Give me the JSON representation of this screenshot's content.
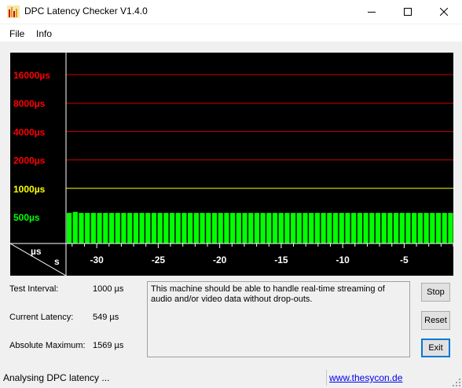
{
  "window": {
    "title": "DPC Latency Checker V1.4.0",
    "icon": "bar-chart-app-icon",
    "controls": [
      "minimize",
      "maximize",
      "close"
    ]
  },
  "menu": {
    "items": [
      "File",
      "Info"
    ]
  },
  "chart_data": {
    "type": "bar",
    "y_scale": "log",
    "y_ticks": [
      {
        "label": "16000µs",
        "value": 16000,
        "color": "#ff0000"
      },
      {
        "label": "8000µs",
        "value": 8000,
        "color": "#ff0000"
      },
      {
        "label": "4000µs",
        "value": 4000,
        "color": "#ff0000"
      },
      {
        "label": "2000µs",
        "value": 2000,
        "color": "#ff0000"
      },
      {
        "label": "1000µs",
        "value": 1000,
        "color": "#ffff00"
      },
      {
        "label": "500µs",
        "value": 500,
        "color": "#00ff00"
      }
    ],
    "x_ticks": [
      "-30",
      "-25",
      "-20",
      "-15",
      "-10",
      "-5"
    ],
    "x_tick_values": [
      -30,
      -25,
      -20,
      -15,
      -10,
      -5
    ],
    "x_range": [
      -32.5,
      -1
    ],
    "y_unit_label": "µs",
    "x_unit_label": "s",
    "bar_color": "#00ff00",
    "background": "#000000",
    "values": [
      549,
      563,
      549,
      549,
      549,
      549,
      549,
      549,
      549,
      549,
      549,
      549,
      549,
      549,
      549,
      549,
      549,
      549,
      549,
      549,
      549,
      549,
      549,
      549,
      549,
      549,
      549,
      549,
      549,
      549,
      549,
      549,
      549,
      549,
      549,
      549,
      549,
      549,
      549,
      549,
      549,
      549,
      549,
      549,
      549,
      549,
      549,
      549,
      549,
      549,
      549,
      549,
      549,
      549,
      549,
      549,
      549,
      549,
      549,
      549,
      549,
      549,
      549,
      549
    ]
  },
  "stats": {
    "test_interval_label": "Test Interval:",
    "test_interval_value": "1000 µs",
    "current_latency_label": "Current Latency:",
    "current_latency_value": "549 µs",
    "absolute_maximum_label": "Absolute Maximum:",
    "absolute_maximum_value": "1569 µs"
  },
  "message": "This machine should be able to handle real-time streaming of audio and/or video data without drop-outs.",
  "buttons": {
    "stop": "Stop",
    "reset": "Reset",
    "exit": "Exit"
  },
  "status": {
    "text": "Analysing DPC latency ...",
    "link": "www.thesycon.de"
  }
}
